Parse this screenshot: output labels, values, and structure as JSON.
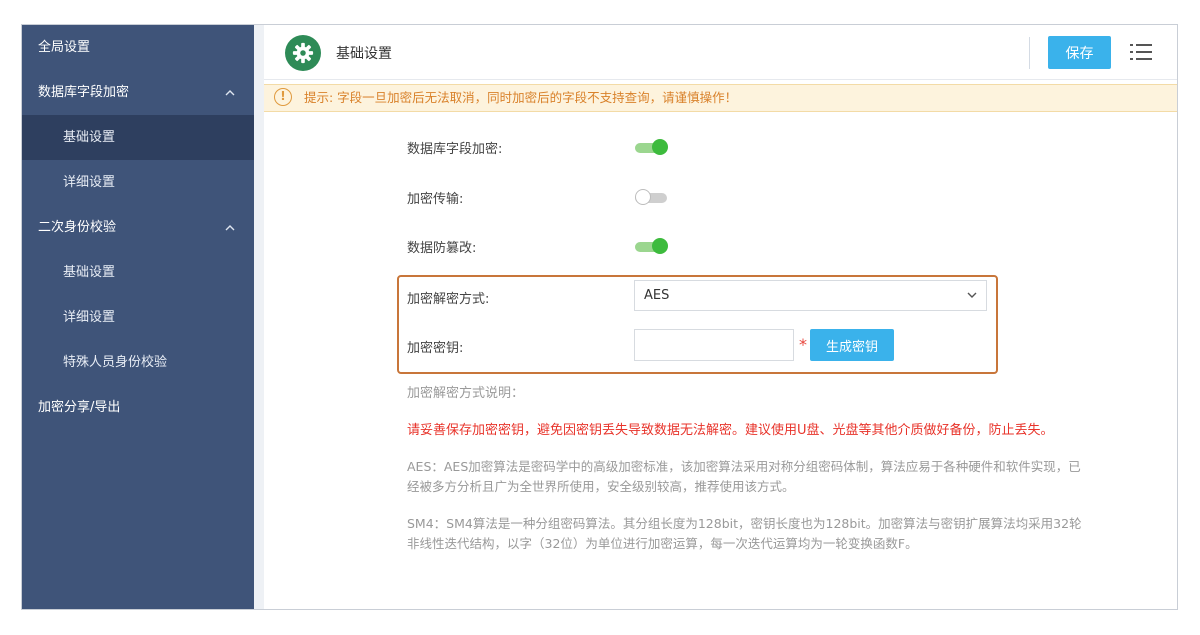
{
  "sidebar": {
    "items": [
      {
        "label": "全局设置"
      },
      {
        "label": "数据库字段加密"
      },
      {
        "label": "基础设置"
      },
      {
        "label": "详细设置"
      },
      {
        "label": "二次身份校验"
      },
      {
        "label": "基础设置"
      },
      {
        "label": "详细设置"
      },
      {
        "label": "特殊人员身份校验"
      },
      {
        "label": "加密分享/导出"
      }
    ]
  },
  "header": {
    "title": "基础设置",
    "save_label": "保存",
    "icons": {
      "settings": "gear-icon",
      "menu": "list-menu-icon"
    }
  },
  "notice": {
    "text": "提示: 字段一旦加密后无法取消，同时加密后的字段不支持查询，请谨慎操作！",
    "icon": "exclamation-circle-icon"
  },
  "form": {
    "db_encrypt_label": "数据库字段加密:",
    "db_encrypt_on": true,
    "transfer_encrypt_label": "加密传输:",
    "transfer_encrypt_on": false,
    "tamper_proof_label": "数据防篡改:",
    "tamper_proof_on": true,
    "method_label": "加密解密方式:",
    "method_value": "AES",
    "key_label": "加密密钥:",
    "key_value": "",
    "required_mark": "*",
    "generate_label": "生成密钥"
  },
  "description": {
    "title": "加密解密方式说明：",
    "warning": "请妥善保存加密密钥，避免因密钥丢失导致数据无法解密。建议使用U盘、光盘等其他介质做好备份，防止丢失。",
    "aes": "AES：AES加密算法是密码学中的高级加密标准，该加密算法采用对称分组密码体制，算法应易于各种硬件和软件实现，已经被多方分析且广为全世界所使用，安全级别较高，推荐使用该方式。",
    "sm4": "SM4：SM4算法是一种分组密码算法。其分组长度为128bit，密钥长度也为128bit。加密算法与密钥扩展算法均采用32轮非线性迭代结构，以字（32位）为单位进行加密运算，每一次迭代运算均为一轮变换函数F。"
  },
  "colors": {
    "sidebar_bg": "#3f5479",
    "sidebar_active": "#2e3f5f",
    "accent": "#3ab2eb",
    "toggle_on": "#3dbb3d",
    "warning": "#e8332a",
    "highlight_border": "#c8763a"
  }
}
